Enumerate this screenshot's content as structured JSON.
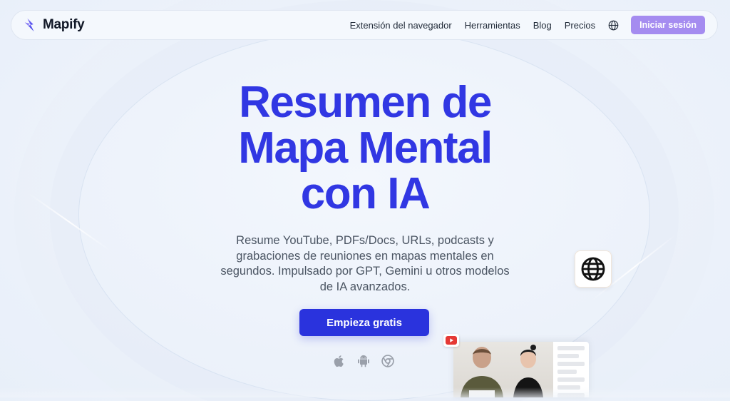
{
  "brand": {
    "name": "Mapify",
    "logo_icon": "lightning-bolt-icon"
  },
  "nav": {
    "links": [
      "Extensión del navegador",
      "Herramientas",
      "Blog",
      "Precios"
    ],
    "language_icon": "globe-icon",
    "login_label": "Iniciar sesión"
  },
  "hero": {
    "title_lines": [
      "Resumen de",
      "Mapa Mental",
      "con IA"
    ],
    "subtitle_lines": [
      "Resume YouTube, PDFs/Docs, URLs, podcasts y",
      "grabaciones de reuniones en mapas mentales en",
      "segundos. Impulsado por GPT, Gemini u otros modelos",
      "de IA avanzados."
    ],
    "cta_label": "Empieza gratis",
    "platform_icons": [
      "apple-icon",
      "android-icon",
      "chrome-icon"
    ]
  },
  "decor": {
    "globe_card_icon": "globe-icon",
    "video_badge_icon": "youtube-icon"
  },
  "colors": {
    "accent": "#3137e3",
    "cta": "#2a33dd",
    "login": "#a58cf0",
    "youtube": "#e53935"
  }
}
